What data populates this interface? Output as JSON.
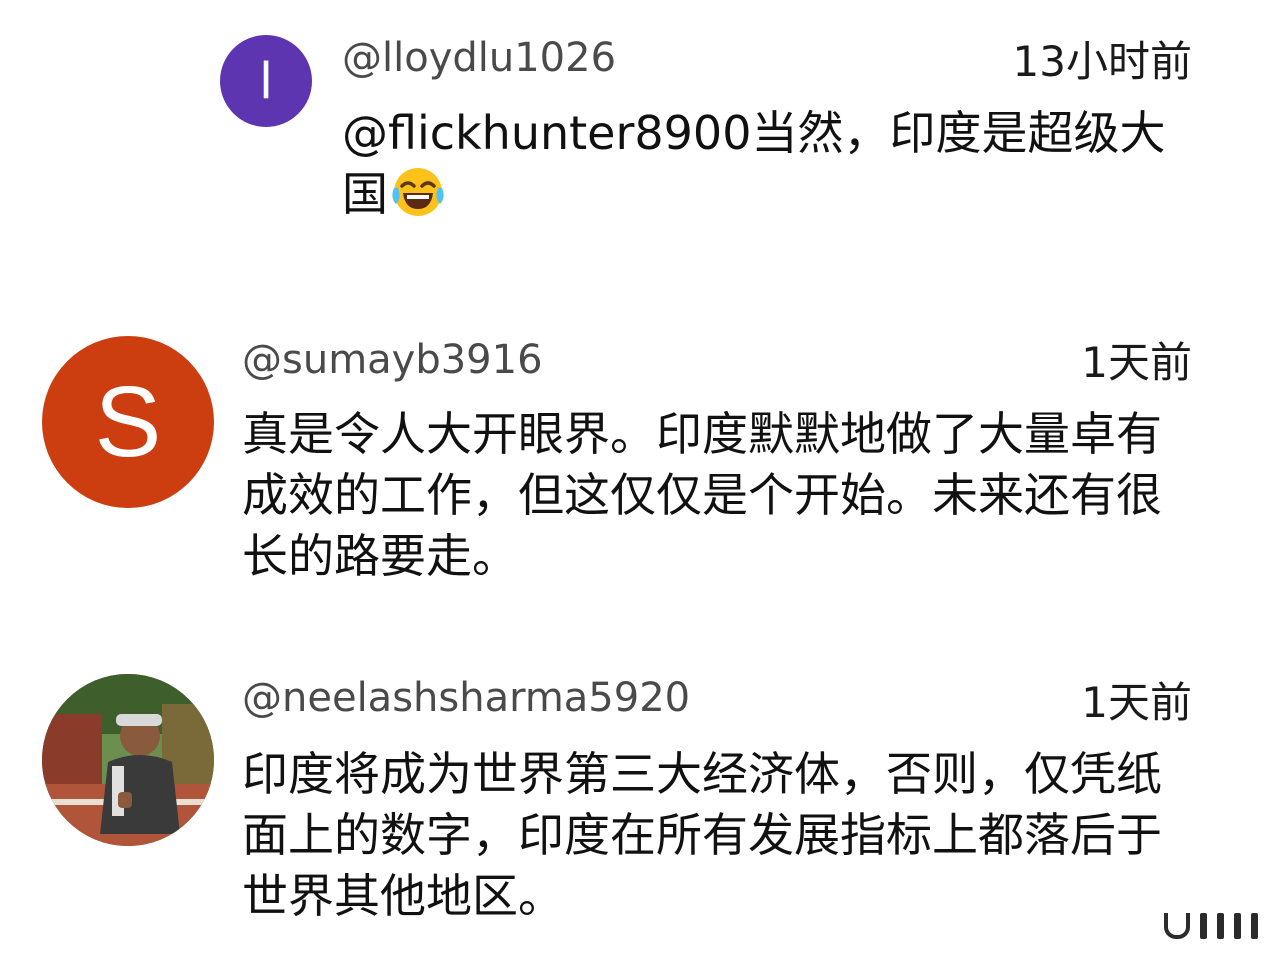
{
  "comments": [
    {
      "handle": "@lloydlu1026",
      "time": "13小时前",
      "avatar_letter": "l",
      "avatar_color": "#5e35b1",
      "text_line1": "@flickhunter8900当然，印度是超级大",
      "text_line2": "国",
      "emoji": "face-with-tears-of-joy-icon"
    },
    {
      "handle": "@sumayb3916",
      "time": "1天前",
      "avatar_letter": "S",
      "avatar_color": "#cc3d0f",
      "text": "真是令人大开眼界。印度默默地做了大量卓有成效的工作，但这仅仅是个开始。未来还有很长的路要走。"
    },
    {
      "handle": "@neelashsharma5920",
      "time": "1天前",
      "avatar_type": "photo",
      "text": "印度将成为世界第三大经济体，否则，仅凭纸面上的数字，印度在所有发展指标上都落后于世界其他地区。"
    }
  ],
  "colors": {
    "background": "#ffffff",
    "text": "#111111",
    "handle": "#4a4a4a"
  }
}
